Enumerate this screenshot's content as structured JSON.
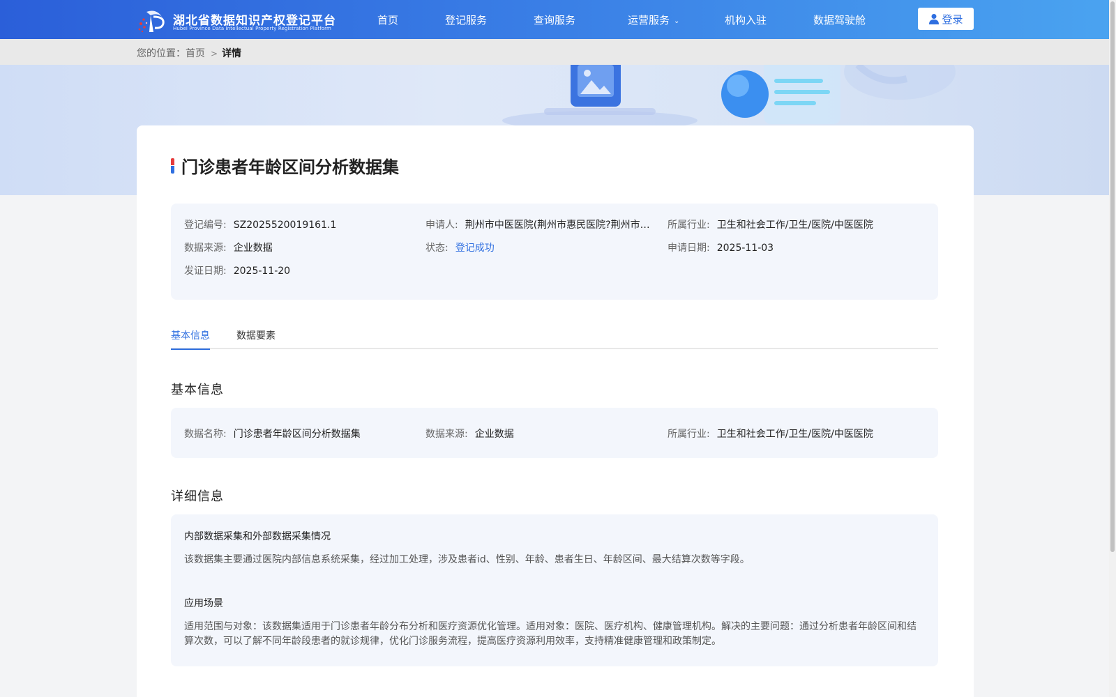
{
  "header": {
    "logo_title": "湖北省数据知识产权登记平台",
    "logo_subtitle": "Hubei Province Data Intellectual Property Registration Platform",
    "nav": [
      {
        "label": "首页"
      },
      {
        "label": "登记服务"
      },
      {
        "label": "查询服务"
      },
      {
        "label": "运营服务"
      },
      {
        "label": "机构入驻"
      },
      {
        "label": "数据驾驶舱"
      }
    ],
    "login_label": "登录"
  },
  "breadcrumb": {
    "prefix": "您的位置：",
    "home": "首页",
    "current": "详情"
  },
  "detail": {
    "title": "门诊患者年龄区间分析数据集",
    "summary": {
      "reg_no_label": "登记编号:",
      "reg_no": "SZ2025520019161.1",
      "applicant_label": "申请人:",
      "applicant": "荆州市中医医院(荆州市惠民医院?荆州市…",
      "industry_label": "所属行业:",
      "industry": "卫生和社会工作/卫生/医院/中医医院",
      "source_label": "数据来源:",
      "source": "企业数据",
      "status_label": "状态:",
      "status": "登记成功",
      "apply_date_label": "申请日期:",
      "apply_date": "2025-11-03",
      "issue_date_label": "发证日期:",
      "issue_date": "2025-11-20"
    },
    "tabs": [
      {
        "label": "基本信息"
      },
      {
        "label": "数据要素"
      }
    ],
    "basic_section_title": "基本信息",
    "basic": {
      "name_label": "数据名称:",
      "name": "门诊患者年龄区间分析数据集",
      "source_label": "数据来源:",
      "source": "企业数据",
      "industry_label": "所属行业:",
      "industry": "卫生和社会工作/卫生/医院/中医医院"
    },
    "detail_section_title": "详细信息",
    "collection_heading": "内部数据采集和外部数据采集情况",
    "collection_text": "该数据集主要通过医院内部信息系统采集，经过加工处理，涉及患者id、性别、年龄、患者生日、年龄区间、最大结算次数等字段。",
    "scenario_heading": "应用场景",
    "scenario_text": "适用范围与对象：该数据集适用于门诊患者年龄分布分析和医疗资源优化管理。适用对象：医院、医疗机构、健康管理机构。解决的主要问题：通过分析患者年龄区间和结算次数，可以了解不同年龄段患者的就诊规律，优化门诊服务流程，提高医疗资源利用效率，支持精准健康管理和政策制定。"
  },
  "colors": {
    "header_gradient_start": "#2b5fd9",
    "header_gradient_end": "#4aa3f0",
    "accent": "#2f6fe0",
    "status_ok": "#2f6fe0",
    "panel_bg": "#f3f6fc"
  },
  "icons": [
    "logo-emblem-icon",
    "chevron-down-icon",
    "user-icon",
    "chevron-right-icon"
  ]
}
